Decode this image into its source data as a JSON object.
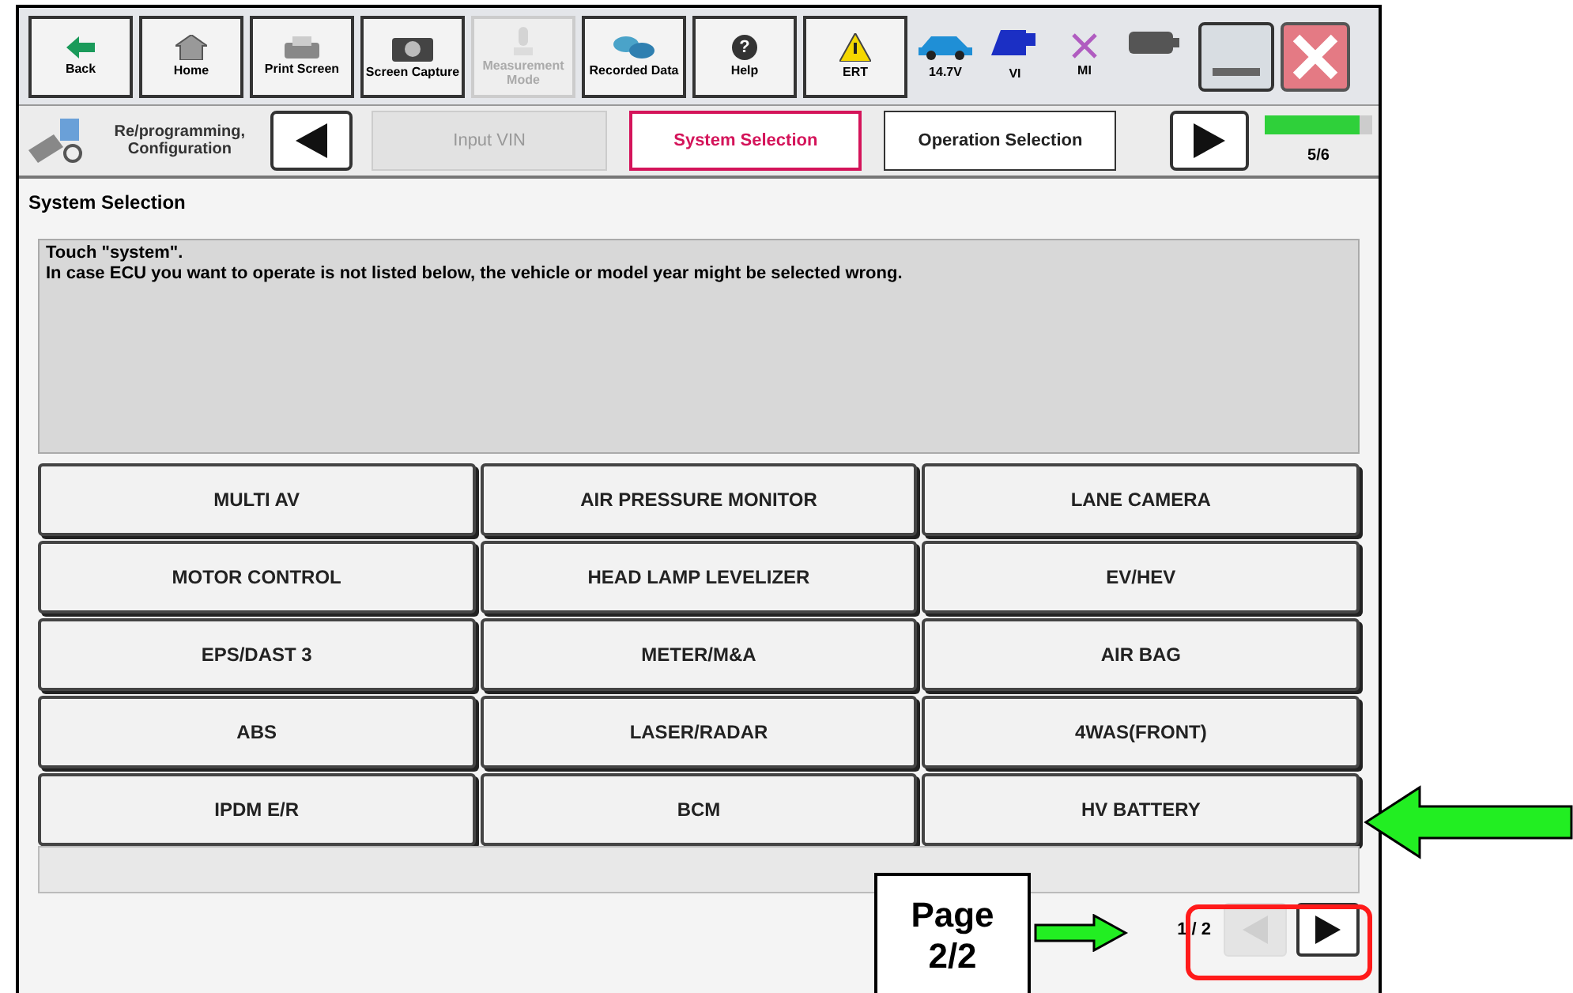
{
  "toolbar": [
    {
      "label": "Back",
      "disabled": false
    },
    {
      "label": "Home",
      "disabled": false
    },
    {
      "label": "Print Screen",
      "disabled": false
    },
    {
      "label": "Screen Capture",
      "disabled": false
    },
    {
      "label": "Measurement Mode",
      "disabled": true
    },
    {
      "label": "Recorded Data",
      "disabled": false
    },
    {
      "label": "Help",
      "glyph": "?",
      "disabled": false
    },
    {
      "label": "ERT",
      "disabled": false
    }
  ],
  "status": [
    {
      "label": "14.7V"
    },
    {
      "label": "VI"
    },
    {
      "label": "MI"
    }
  ],
  "nav": {
    "section": "Re/programming, Configuration",
    "steps": [
      {
        "label": "Input VIN",
        "selected": false,
        "disabled": true
      },
      {
        "label": "System Selection",
        "selected": true,
        "disabled": false
      },
      {
        "label": "Operation Selection",
        "selected": false,
        "disabled": false
      }
    ],
    "progress": {
      "level": 0.88,
      "reading": "5/6"
    }
  },
  "page_title": "System Selection",
  "message": [
    "Touch \"system\".",
    "In case ECU you want to operate is not listed below, the vehicle or model year might be selected wrong."
  ],
  "systems": [
    "MULTI AV",
    "AIR PRESSURE MONITOR",
    "LANE CAMERA",
    "MOTOR CONTROL",
    "HEAD LAMP LEVELIZER",
    "EV/HEV",
    "EPS/DAST 3",
    "METER/M&A",
    "AIR BAG",
    "ABS",
    "LASER/RADAR",
    "4WAS(FRONT)",
    "IPDM E/R",
    "BCM",
    "HV BATTERY"
  ],
  "pager": {
    "reading": "1 / 2",
    "prev_disabled": true,
    "next_disabled": false
  },
  "annotations": {
    "callout": "Page 2/2"
  }
}
